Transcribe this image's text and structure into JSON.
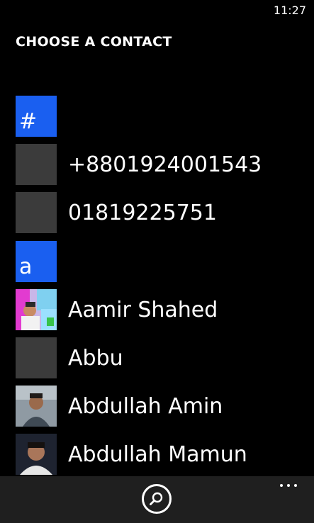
{
  "status_bar": {
    "time": "11:27"
  },
  "page": {
    "title": "CHOOSE A CONTACT"
  },
  "groups": {
    "hash": "#",
    "a": "a"
  },
  "contacts": {
    "c1": {
      "name": "+8801924001543",
      "avatar": "placeholder"
    },
    "c2": {
      "name": "01819225751",
      "avatar": "placeholder"
    },
    "c3": {
      "name": "Aamir Shahed",
      "avatar": "photo"
    },
    "c4": {
      "name": "Abbu",
      "avatar": "placeholder"
    },
    "c5": {
      "name": "Abdullah Amin",
      "avatar": "photo"
    },
    "c6": {
      "name": "Abdullah Mamun",
      "avatar": "photo"
    }
  },
  "app_bar": {
    "search_icon": "search-icon",
    "more_icon": "ellipsis-icon"
  },
  "colors": {
    "background": "#000000",
    "accent": "#1a5ff0",
    "placeholder_tile": "#3b3b3b",
    "app_bar": "#1f1f1f"
  }
}
